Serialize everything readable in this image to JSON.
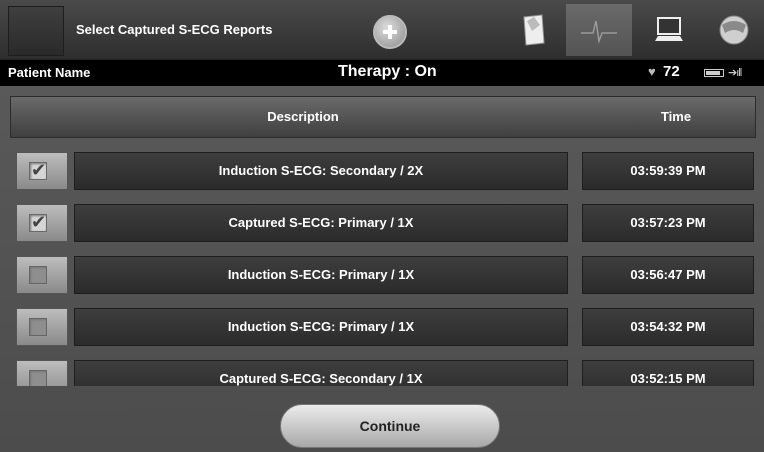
{
  "toolbar": {
    "title": "Select Captured S-ECG Reports",
    "tools": [
      {
        "icon": "notes-icon"
      },
      {
        "icon": "waveform-icon",
        "active": true
      },
      {
        "icon": "computer-icon"
      },
      {
        "icon": "device-icon"
      }
    ]
  },
  "status": {
    "patient_label": "Patient Name",
    "therapy": "Therapy : On",
    "heart_rate": "72"
  },
  "table": {
    "headers": {
      "description": "Description",
      "time": "Time"
    },
    "rows": [
      {
        "checked": true,
        "description": "Induction S-ECG: Secondary / 2X",
        "time": "03:59:39 PM"
      },
      {
        "checked": true,
        "description": "Captured S-ECG: Primary / 1X",
        "time": "03:57:23 PM"
      },
      {
        "checked": false,
        "description": "Induction S-ECG: Primary / 1X",
        "time": "03:56:47 PM"
      },
      {
        "checked": false,
        "description": "Induction S-ECG: Primary / 1X",
        "time": "03:54:32 PM"
      },
      {
        "checked": false,
        "description": "Captured S-ECG: Secondary / 1X",
        "time": "03:52:15 PM"
      }
    ]
  },
  "actions": {
    "continue_label": "Continue"
  },
  "colors": {
    "background": "#3a3a3a",
    "panel": "#545454",
    "cell": "#333333",
    "button": "#d0d0d0"
  }
}
